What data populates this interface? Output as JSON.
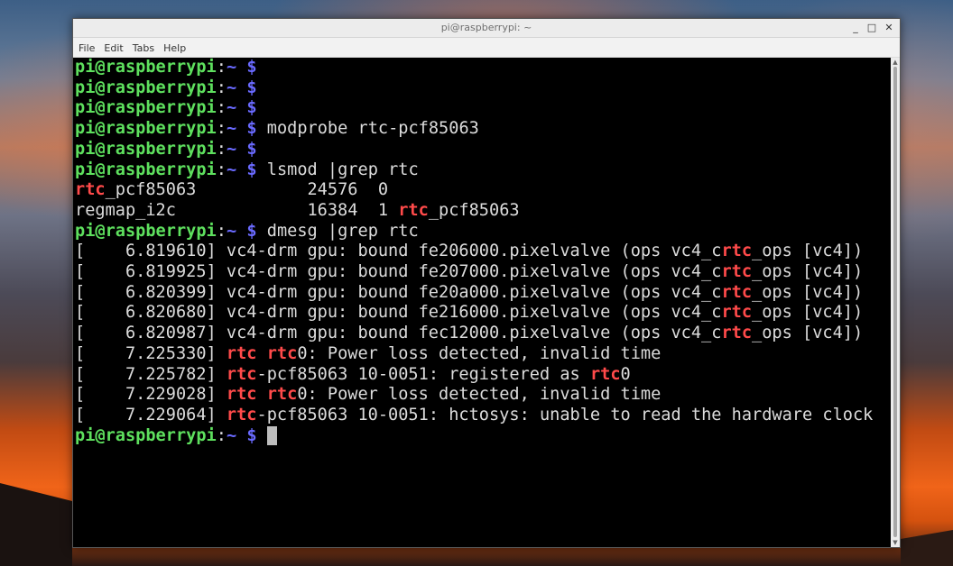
{
  "window": {
    "title": "pi@raspberrypi: ~",
    "controls": {
      "minimize": "_",
      "maximize": "□",
      "close": "✕"
    }
  },
  "menu": [
    "File",
    "Edit",
    "Tabs",
    "Help"
  ],
  "prompt": {
    "user": "pi@raspberrypi",
    "sep": ":",
    "path": "~",
    "dollar": "$"
  },
  "lines": [
    {
      "type": "prompt",
      "cmd": ""
    },
    {
      "type": "prompt",
      "cmd": ""
    },
    {
      "type": "prompt",
      "cmd": ""
    },
    {
      "type": "prompt",
      "cmd": "modprobe rtc-pcf85063"
    },
    {
      "type": "prompt",
      "cmd": ""
    },
    {
      "type": "prompt",
      "cmd": "lsmod |grep rtc"
    },
    {
      "type": "output",
      "parts": [
        [
          "rtc",
          true
        ],
        [
          "_pcf85063           24576  0",
          false
        ]
      ]
    },
    {
      "type": "output",
      "parts": [
        [
          "regmap_i2c             16384  1 ",
          false
        ],
        [
          "rtc",
          true
        ],
        [
          "_pcf85063",
          false
        ]
      ]
    },
    {
      "type": "prompt",
      "cmd": "dmesg |grep rtc"
    },
    {
      "type": "output",
      "parts": [
        [
          "[    6.819610] vc4-drm gpu: bound fe206000.pixelvalve (ops vc4_c",
          false
        ],
        [
          "rtc",
          true
        ],
        [
          "_ops [vc4])",
          false
        ]
      ]
    },
    {
      "type": "output",
      "parts": [
        [
          "[    6.819925] vc4-drm gpu: bound fe207000.pixelvalve (ops vc4_c",
          false
        ],
        [
          "rtc",
          true
        ],
        [
          "_ops [vc4])",
          false
        ]
      ]
    },
    {
      "type": "output",
      "parts": [
        [
          "[    6.820399] vc4-drm gpu: bound fe20a000.pixelvalve (ops vc4_c",
          false
        ],
        [
          "rtc",
          true
        ],
        [
          "_ops [vc4])",
          false
        ]
      ]
    },
    {
      "type": "output",
      "parts": [
        [
          "[    6.820680] vc4-drm gpu: bound fe216000.pixelvalve (ops vc4_c",
          false
        ],
        [
          "rtc",
          true
        ],
        [
          "_ops [vc4])",
          false
        ]
      ]
    },
    {
      "type": "output",
      "parts": [
        [
          "[    6.820987] vc4-drm gpu: bound fec12000.pixelvalve (ops vc4_c",
          false
        ],
        [
          "rtc",
          true
        ],
        [
          "_ops [vc4])",
          false
        ]
      ]
    },
    {
      "type": "output",
      "parts": [
        [
          "[    7.225330] ",
          false
        ],
        [
          "rtc",
          true
        ],
        [
          " ",
          false
        ],
        [
          "rtc",
          true
        ],
        [
          "0: Power loss detected, invalid time",
          false
        ]
      ]
    },
    {
      "type": "output",
      "parts": [
        [
          "[    7.225782] ",
          false
        ],
        [
          "rtc",
          true
        ],
        [
          "-pcf85063 10-0051: registered as ",
          false
        ],
        [
          "rtc",
          true
        ],
        [
          "0",
          false
        ]
      ]
    },
    {
      "type": "output",
      "parts": [
        [
          "[    7.229028] ",
          false
        ],
        [
          "rtc",
          true
        ],
        [
          " ",
          false
        ],
        [
          "rtc",
          true
        ],
        [
          "0: Power loss detected, invalid time",
          false
        ]
      ]
    },
    {
      "type": "output",
      "parts": [
        [
          "[    7.229064] ",
          false
        ],
        [
          "rtc",
          true
        ],
        [
          "-pcf85063 10-0051: hctosys: unable to read the hardware clock",
          false
        ]
      ]
    },
    {
      "type": "prompt",
      "cmd": "",
      "cursor": true
    }
  ]
}
